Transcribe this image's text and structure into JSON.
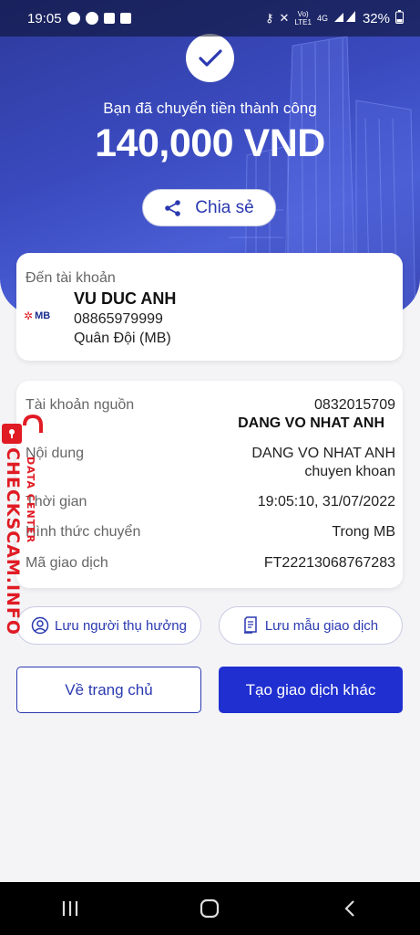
{
  "status_bar": {
    "time": "19:05",
    "network": "4G",
    "network_sub": "LTE1",
    "volte": "Vo)",
    "battery": "32%"
  },
  "hero": {
    "title": "Bạn đã chuyển tiền thành công",
    "amount": "140,000 VND",
    "share_label": "Chia sẻ",
    "check_icon": "check-icon",
    "share_icon": "share-icon"
  },
  "recipient": {
    "label": "Đến tài khoản",
    "bank_logo": "MB",
    "name": "VU DUC ANH",
    "account": "08865979999",
    "bank": "Quân Đội (MB)"
  },
  "details": [
    {
      "key": "Tài khoản nguồn",
      "value": "0832015709",
      "value2": "DANG VO NHAT ANH"
    },
    {
      "key": "Nội dung",
      "value": "DANG VO NHAT ANH",
      "value2": "chuyen khoan"
    },
    {
      "key": "Thời gian",
      "value": "19:05:10, 31/07/2022"
    },
    {
      "key": "Hình thức chuyển",
      "value": "Trong MB"
    },
    {
      "key": "Mã giao dịch",
      "value": "FT22213068767283"
    }
  ],
  "actions": {
    "save_beneficiary": "Lưu người thụ hưởng",
    "save_template": "Lưu mẫu giao dịch",
    "home": "Về trang chủ",
    "new_transaction": "Tạo giao dịch khác"
  },
  "watermark": {
    "main": "CHECKSCAM.INFO",
    "sub": "DATA CENTER"
  },
  "colors": {
    "primary": "#1f2fd0",
    "accent_text": "#2a39b0",
    "hero_bg": "#3b4bc0",
    "watermark": "#e01b24"
  }
}
